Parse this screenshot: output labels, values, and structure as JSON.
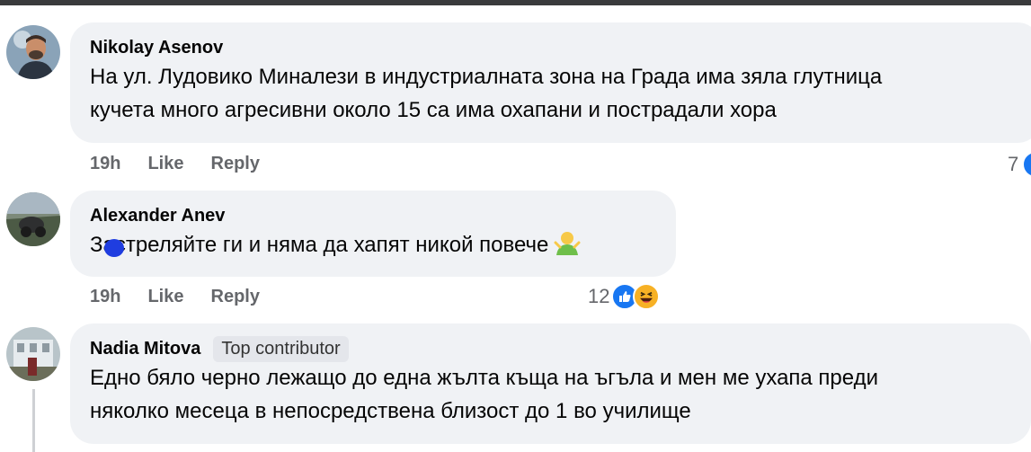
{
  "comments": [
    {
      "author": "Nikolay Asenov",
      "text_line1": "На ул. Лудовико Миналези в индустриалната зона на Града има зяла глутница",
      "text_line2": "кучета много агресивни около 15 са има охапани и пострадали хора",
      "time": "19h",
      "like_label": "Like",
      "reply_label": "Reply",
      "reaction_count": "7"
    },
    {
      "author": "Alexander Anev",
      "text": "Застреляйте ги и няма да хапят никой повече",
      "time": "19h",
      "like_label": "Like",
      "reply_label": "Reply",
      "reaction_count": "12",
      "reaction_icons": [
        "like-icon",
        "haha-icon"
      ]
    },
    {
      "author": "Nadia Mitova",
      "badge": "Top contributor",
      "text_line1": "Едно бяло черно лежащо до една жълта къща на ъгъла и мен ме ухапа преди",
      "text_line2": "няколко месеца в непосредствена близост до 1 во училище"
    }
  ],
  "colors": {
    "bubble": "#f0f2f5",
    "secondary_text": "#65676b",
    "like_blue": "#1877f2",
    "haha_yellow": "#f7b125"
  }
}
